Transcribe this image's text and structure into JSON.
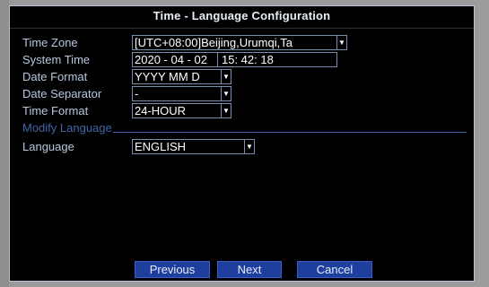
{
  "window": {
    "title": "Time - Language Configuration"
  },
  "fields": {
    "time_zone": {
      "label": "Time Zone",
      "value": "[UTC+08:00]Beijing,Urumqi,Ta"
    },
    "system_time": {
      "label": "System Time",
      "date": "2020 - 04 - 02",
      "time": "15: 42: 18"
    },
    "date_format": {
      "label": "Date Format",
      "value": "YYYY MM D"
    },
    "date_separator": {
      "label": "Date Separator",
      "value": "-"
    },
    "time_format": {
      "label": "Time Format",
      "value": "24-HOUR"
    },
    "language": {
      "label": "Language",
      "value": "ENGLISH"
    }
  },
  "sections": {
    "modify_language": "Modify Language"
  },
  "buttons": {
    "previous": "Previous",
    "next": "Next",
    "cancel": "Cancel"
  },
  "icons": {
    "dropdown": "chevron-down-icon"
  },
  "colors": {
    "label": "#b6c8df",
    "section": "#3f64a8",
    "button_bg": "#1f3f9e",
    "field_border": "#7a8fb0"
  }
}
